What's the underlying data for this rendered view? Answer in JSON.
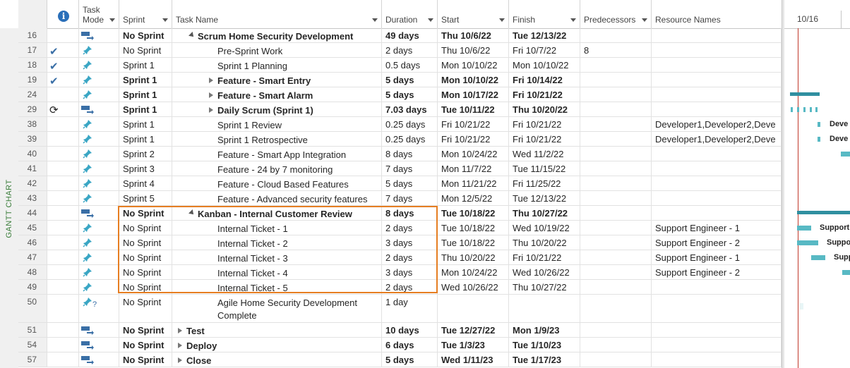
{
  "side_label": "GANTT CHART",
  "columns": {
    "info": "i",
    "task_mode": "Task\nMode",
    "sprint": "Sprint",
    "task_name": "Task Name",
    "duration": "Duration",
    "start": "Start",
    "finish": "Finish",
    "predecessors": "Predecessors",
    "resource_names": "Resource Names"
  },
  "rows": [
    {
      "id": "16",
      "ind": "",
      "mode": "auto",
      "sprint": "No Sprint",
      "name": "Scrum Home Security Development",
      "duration": "49 days",
      "start": "Thu 10/6/22",
      "finish": "Tue 12/13/22",
      "pred": "",
      "res": "",
      "bold": true,
      "level": 1,
      "outline": "down"
    },
    {
      "id": "17",
      "ind": "check",
      "mode": "pin",
      "sprint": "No Sprint",
      "name": "Pre-Sprint Work",
      "duration": "2 days",
      "start": "Thu 10/6/22",
      "finish": "Fri 10/7/22",
      "pred": "8",
      "res": "",
      "bold": false,
      "level": 2,
      "outline": ""
    },
    {
      "id": "18",
      "ind": "check",
      "mode": "pin",
      "sprint": "Sprint 1",
      "name": "Sprint 1 Planning",
      "duration": "0.5 days",
      "start": "Mon 10/10/22",
      "finish": "Mon 10/10/22",
      "pred": "",
      "res": "",
      "bold": false,
      "level": 2,
      "outline": ""
    },
    {
      "id": "19",
      "ind": "check",
      "mode": "pin",
      "sprint": "Sprint 1",
      "name": "Feature - Smart Entry",
      "duration": "5 days",
      "start": "Mon 10/10/22",
      "finish": "Fri 10/14/22",
      "pred": "",
      "res": "",
      "bold": true,
      "level": 2,
      "outline": "right"
    },
    {
      "id": "24",
      "ind": "",
      "mode": "pin",
      "sprint": "Sprint 1",
      "name": "Feature - Smart Alarm",
      "duration": "5 days",
      "start": "Mon 10/17/22",
      "finish": "Fri 10/21/22",
      "pred": "",
      "res": "",
      "bold": true,
      "level": 2,
      "outline": "right"
    },
    {
      "id": "29",
      "ind": "recur",
      "mode": "auto",
      "sprint": "Sprint 1",
      "name": "Daily Scrum (Sprint 1)",
      "duration": "7.03 days",
      "start": "Tue 10/11/22",
      "finish": "Thu 10/20/22",
      "pred": "",
      "res": "",
      "bold": true,
      "level": 2,
      "outline": "right"
    },
    {
      "id": "38",
      "ind": "",
      "mode": "pin",
      "sprint": "Sprint 1",
      "name": "Sprint 1 Review",
      "duration": "0.25 days",
      "start": "Fri 10/21/22",
      "finish": "Fri 10/21/22",
      "pred": "",
      "res": "Developer1,Developer2,Deve",
      "bold": false,
      "level": 2,
      "outline": ""
    },
    {
      "id": "39",
      "ind": "",
      "mode": "pin",
      "sprint": "Sprint 1",
      "name": "Sprint 1 Retrospective",
      "duration": "0.25 days",
      "start": "Fri 10/21/22",
      "finish": "Fri 10/21/22",
      "pred": "",
      "res": "Developer1,Developer2,Deve",
      "bold": false,
      "level": 2,
      "outline": ""
    },
    {
      "id": "40",
      "ind": "",
      "mode": "pin",
      "sprint": "Sprint 2",
      "name": "Feature - Smart App Integration",
      "duration": "8 days",
      "start": "Mon 10/24/22",
      "finish": "Wed 11/2/22",
      "pred": "",
      "res": "",
      "bold": false,
      "level": 2,
      "outline": ""
    },
    {
      "id": "41",
      "ind": "",
      "mode": "pin",
      "sprint": "Sprint 3",
      "name": "Feature - 24 by 7 monitoring",
      "duration": "7 days",
      "start": "Mon 11/7/22",
      "finish": "Tue 11/15/22",
      "pred": "",
      "res": "",
      "bold": false,
      "level": 2,
      "outline": ""
    },
    {
      "id": "42",
      "ind": "",
      "mode": "pin",
      "sprint": "Sprint 4",
      "name": "Feature - Cloud Based Features",
      "duration": "5 days",
      "start": "Mon 11/21/22",
      "finish": "Fri 11/25/22",
      "pred": "",
      "res": "",
      "bold": false,
      "level": 2,
      "outline": ""
    },
    {
      "id": "43",
      "ind": "",
      "mode": "pin",
      "sprint": "Sprint 5",
      "name": "Feature - Advanced security features",
      "duration": "7 days",
      "start": "Mon 12/5/22",
      "finish": "Tue 12/13/22",
      "pred": "",
      "res": "",
      "bold": false,
      "level": 2,
      "outline": ""
    },
    {
      "id": "44",
      "ind": "",
      "mode": "auto",
      "sprint": "No Sprint",
      "name": "Kanban - Internal Customer Review",
      "duration": "8 days",
      "start": "Tue 10/18/22",
      "finish": "Thu 10/27/22",
      "pred": "",
      "res": "",
      "bold": true,
      "level": 1,
      "outline": "down"
    },
    {
      "id": "45",
      "ind": "",
      "mode": "pin",
      "sprint": "No Sprint",
      "name": "Internal Ticket - 1",
      "duration": "2 days",
      "start": "Tue 10/18/22",
      "finish": "Wed 10/19/22",
      "pred": "",
      "res": "Support Engineer - 1",
      "bold": false,
      "level": 2,
      "outline": ""
    },
    {
      "id": "46",
      "ind": "",
      "mode": "pin",
      "sprint": "No Sprint",
      "name": "Internal Ticket - 2",
      "duration": "3 days",
      "start": "Tue 10/18/22",
      "finish": "Thu 10/20/22",
      "pred": "",
      "res": "Support Engineer - 2",
      "bold": false,
      "level": 2,
      "outline": ""
    },
    {
      "id": "47",
      "ind": "",
      "mode": "pin",
      "sprint": "No Sprint",
      "name": "Internal Ticket - 3",
      "duration": "2 days",
      "start": "Thu 10/20/22",
      "finish": "Fri 10/21/22",
      "pred": "",
      "res": "Support Engineer - 1",
      "bold": false,
      "level": 2,
      "outline": ""
    },
    {
      "id": "48",
      "ind": "",
      "mode": "pin",
      "sprint": "No Sprint",
      "name": "Internal Ticket - 4",
      "duration": "3 days",
      "start": "Mon 10/24/22",
      "finish": "Wed 10/26/22",
      "pred": "",
      "res": "Support Engineer - 2",
      "bold": false,
      "level": 2,
      "outline": ""
    },
    {
      "id": "49",
      "ind": "",
      "mode": "pin",
      "sprint": "No Sprint",
      "name": "Internal Ticket - 5",
      "duration": "2 days",
      "start": "Wed 10/26/22",
      "finish": "Thu 10/27/22",
      "pred": "",
      "res": "",
      "bold": false,
      "level": 2,
      "outline": ""
    },
    {
      "id": "50",
      "ind": "",
      "mode": "pinq",
      "sprint": "No Sprint",
      "name": "Agile Home Security Development\nComplete",
      "duration": "1 day",
      "start": "",
      "finish": "",
      "pred": "",
      "res": "",
      "bold": false,
      "level": 2,
      "outline": "",
      "tall": true
    },
    {
      "id": "51",
      "ind": "",
      "mode": "auto",
      "sprint": "No Sprint",
      "name": "Test",
      "duration": "10 days",
      "start": "Tue 12/27/22",
      "finish": "Mon 1/9/23",
      "pred": "",
      "res": "",
      "bold": true,
      "level": 0,
      "outline": "right"
    },
    {
      "id": "54",
      "ind": "",
      "mode": "auto",
      "sprint": "No Sprint",
      "name": "Deploy",
      "duration": "6 days",
      "start": "Tue 1/3/23",
      "finish": "Tue 1/10/23",
      "pred": "",
      "res": "",
      "bold": true,
      "level": 0,
      "outline": "right"
    },
    {
      "id": "57",
      "ind": "",
      "mode": "auto",
      "sprint": "No Sprint",
      "name": "Close",
      "duration": "5 days",
      "start": "Wed 1/11/23",
      "finish": "Tue 1/17/23",
      "pred": "",
      "res": "",
      "bold": true,
      "level": 0,
      "outline": "right"
    }
  ],
  "gantt": {
    "timescale_label": "10/16",
    "today_color": "#c0392b",
    "bar_color": "#58b9c4",
    "bar_labels": {
      "38": "Deve",
      "39": "Deve",
      "45": "Support",
      "46": "Suppo",
      "47": "Supp"
    }
  },
  "highlight_color": "#e67e22"
}
